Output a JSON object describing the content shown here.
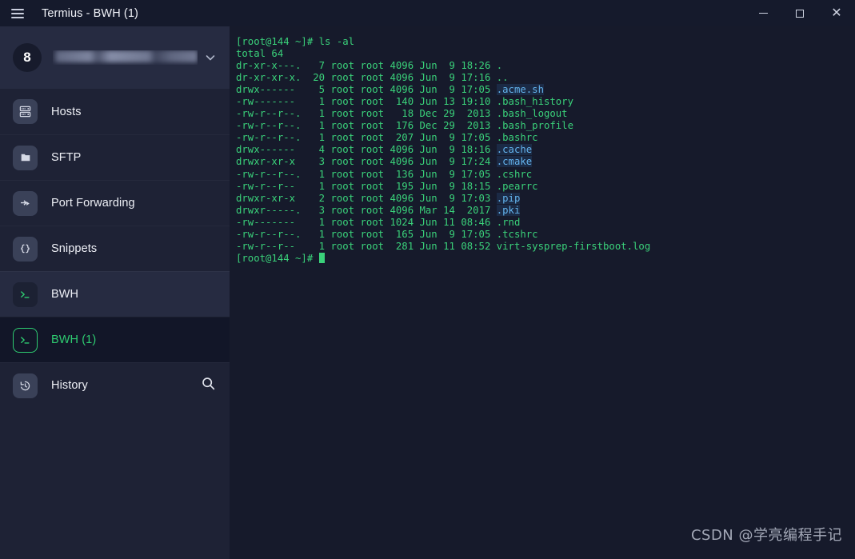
{
  "window": {
    "title": "Termius - BWH (1)",
    "menu_icon": "hamburger-icon",
    "minimize_label": "—",
    "maximize_label": "□",
    "close_label": "✕"
  },
  "account": {
    "badge": "8",
    "name_redacted": "█████ ████ ███",
    "chevron": "⌄"
  },
  "sidebar": {
    "items": [
      {
        "label": "Hosts",
        "icon": "server-icon",
        "state": "normal"
      },
      {
        "label": "SFTP",
        "icon": "folder-icon",
        "state": "normal"
      },
      {
        "label": "Port Forwarding",
        "icon": "port-forward-icon",
        "state": "normal"
      },
      {
        "label": "Snippets",
        "icon": "braces-icon",
        "state": "normal"
      },
      {
        "label": "BWH",
        "icon": "terminal-icon",
        "state": "hovered"
      },
      {
        "label": "BWH (1)",
        "icon": "terminal-icon",
        "state": "active"
      },
      {
        "label": "History",
        "icon": "history-clock-icon",
        "state": "normal"
      }
    ],
    "search_icon": "search-icon"
  },
  "terminal": {
    "prompt": "[root@144 ~]#",
    "command": "ls -al",
    "total_line": "total 64",
    "rows": [
      {
        "perm": "dr-xr-x---.",
        "links": " 7",
        "owner": "root",
        "group": "root",
        "size": "4096",
        "month": "Jun",
        "day": " 9",
        "time": "18:26",
        "name": ".",
        "kind": "dir-plain"
      },
      {
        "perm": "dr-xr-xr-x.",
        "links": "20",
        "owner": "root",
        "group": "root",
        "size": "4096",
        "month": "Jun",
        "day": " 9",
        "time": "17:16",
        "name": "..",
        "kind": "dir-plain"
      },
      {
        "perm": "drwx------",
        "links": " 5",
        "owner": "root",
        "group": "root",
        "size": "4096",
        "month": "Jun",
        "day": " 9",
        "time": "17:05",
        "name": ".acme.sh",
        "kind": "dir-hl"
      },
      {
        "perm": "-rw-------",
        "links": " 1",
        "owner": "root",
        "group": "root",
        "size": " 140",
        "month": "Jun",
        "day": "13",
        "time": "19:10",
        "name": ".bash_history",
        "kind": "file"
      },
      {
        "perm": "-rw-r--r--.",
        "links": " 1",
        "owner": "root",
        "group": "root",
        "size": "  18",
        "month": "Dec",
        "day": "29",
        "time": " 2013",
        "name": ".bash_logout",
        "kind": "file"
      },
      {
        "perm": "-rw-r--r--.",
        "links": " 1",
        "owner": "root",
        "group": "root",
        "size": " 176",
        "month": "Dec",
        "day": "29",
        "time": " 2013",
        "name": ".bash_profile",
        "kind": "file"
      },
      {
        "perm": "-rw-r--r--.",
        "links": " 1",
        "owner": "root",
        "group": "root",
        "size": " 207",
        "month": "Jun",
        "day": " 9",
        "time": "17:05",
        "name": ".bashrc",
        "kind": "file"
      },
      {
        "perm": "drwx------",
        "links": " 4",
        "owner": "root",
        "group": "root",
        "size": "4096",
        "month": "Jun",
        "day": " 9",
        "time": "18:16",
        "name": ".cache",
        "kind": "dir-hl"
      },
      {
        "perm": "drwxr-xr-x",
        "links": " 3",
        "owner": "root",
        "group": "root",
        "size": "4096",
        "month": "Jun",
        "day": " 9",
        "time": "17:24",
        "name": ".cmake",
        "kind": "dir-hl"
      },
      {
        "perm": "-rw-r--r--.",
        "links": " 1",
        "owner": "root",
        "group": "root",
        "size": " 136",
        "month": "Jun",
        "day": " 9",
        "time": "17:05",
        "name": ".cshrc",
        "kind": "file"
      },
      {
        "perm": "-rw-r--r--",
        "links": " 1",
        "owner": "root",
        "group": "root",
        "size": " 195",
        "month": "Jun",
        "day": " 9",
        "time": "18:15",
        "name": ".pearrc",
        "kind": "file"
      },
      {
        "perm": "drwxr-xr-x",
        "links": " 2",
        "owner": "root",
        "group": "root",
        "size": "4096",
        "month": "Jun",
        "day": " 9",
        "time": "17:03",
        "name": ".pip",
        "kind": "dir-hl"
      },
      {
        "perm": "drwxr-----.",
        "links": " 3",
        "owner": "root",
        "group": "root",
        "size": "4096",
        "month": "Mar",
        "day": "14",
        "time": " 2017",
        "name": ".pki",
        "kind": "dir-hl"
      },
      {
        "perm": "-rw-------",
        "links": " 1",
        "owner": "root",
        "group": "root",
        "size": "1024",
        "month": "Jun",
        "day": "11",
        "time": "08:46",
        "name": ".rnd",
        "kind": "file"
      },
      {
        "perm": "-rw-r--r--.",
        "links": " 1",
        "owner": "root",
        "group": "root",
        "size": " 165",
        "month": "Jun",
        "day": " 9",
        "time": "17:05",
        "name": ".tcshrc",
        "kind": "file"
      },
      {
        "perm": "-rw-r--r--",
        "links": " 1",
        "owner": "root",
        "group": "root",
        "size": " 281",
        "month": "Jun",
        "day": "11",
        "time": "08:52",
        "name": "virt-sysprep-firstboot.log",
        "kind": "file"
      }
    ]
  },
  "watermark": {
    "text": "CSDN @学亮编程手记"
  },
  "colors": {
    "titlebar_bg": "#151a2c",
    "sidebar_bg": "#1e2235",
    "terminal_bg": "#161a2b",
    "accent_green": "#2ecc71",
    "terminal_green": "#3ad17a",
    "dir_blue": "#3f8fe0"
  }
}
